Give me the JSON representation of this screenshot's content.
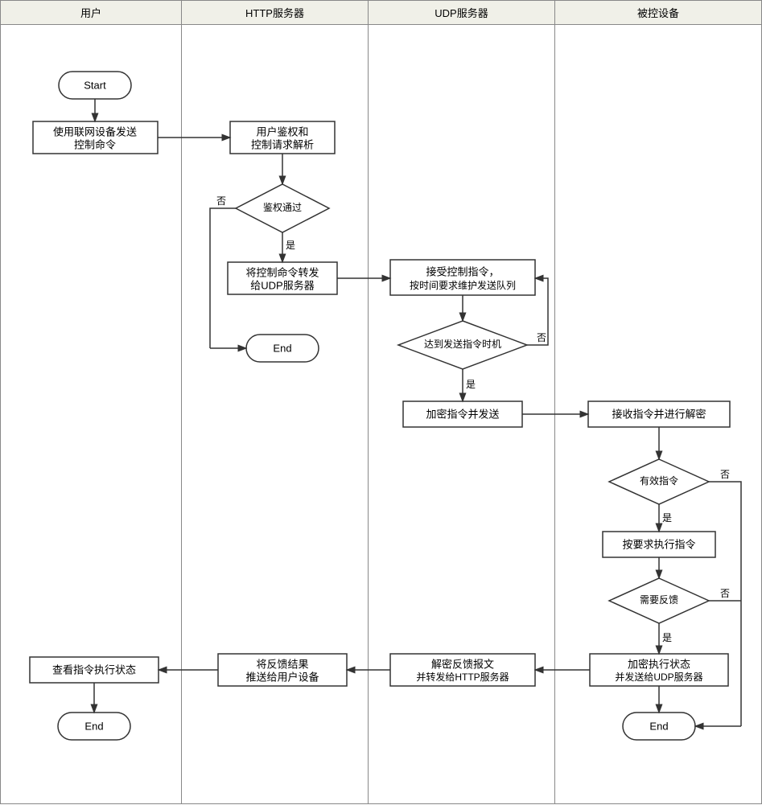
{
  "lanes": {
    "user": "用户",
    "http": "HTTP服务器",
    "udp": "UDP服务器",
    "device": "被控设备"
  },
  "nodes": {
    "start": "Start",
    "end1": "End",
    "end2": "End",
    "end3": "End",
    "send_cmd": {
      "l1": "使用联网设备发送",
      "l2": "控制命令"
    },
    "auth_parse": {
      "l1": "用户鉴权和",
      "l2": "控制请求解析"
    },
    "decision_auth": "鉴权通过",
    "forward_udp": {
      "l1": "将控制命令转发",
      "l2": "给UDP服务器"
    },
    "recv_cmd": {
      "l1": "接受控制指令，",
      "l2": "按时间要求维护发送队列"
    },
    "decision_time": "达到发送指令时机",
    "encrypt_send": "加密指令并发送",
    "recv_decrypt": "接收指令并进行解密",
    "decision_valid": "有效指令",
    "execute": "按要求执行指令",
    "decision_feedback": "需要反馈",
    "encrypt_status": {
      "l1": "加密执行状态",
      "l2": "并发送给UDP服务器"
    },
    "decrypt_forward": {
      "l1": "解密反馈报文",
      "l2": "并转发给HTTP服务器"
    },
    "push_result": {
      "l1": "将反馈结果",
      "l2": "推送给用户设备"
    },
    "view_status": "查看指令执行状态"
  },
  "labels": {
    "yes": "是",
    "no": "否"
  }
}
